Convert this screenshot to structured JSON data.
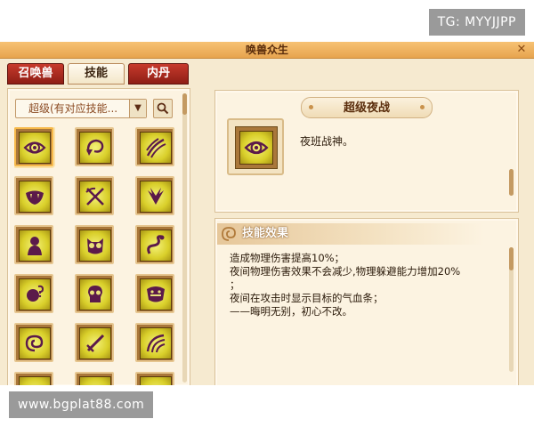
{
  "watermarks": {
    "top_right": "TG: MYYJJPP",
    "bottom_left": "www.bgplat88.com"
  },
  "window": {
    "title": "唤兽众生",
    "close_glyph": "✕"
  },
  "tabs": [
    {
      "label": "召唤兽",
      "active": false
    },
    {
      "label": "技能",
      "active": true
    },
    {
      "label": "内丹",
      "active": false
    }
  ],
  "filter": {
    "selected": "超级(有对应技能...",
    "arrow_glyph": "▼"
  },
  "skills": [
    {
      "icon": "eye-icon",
      "selected": true
    },
    {
      "icon": "swirl-arrow-icon"
    },
    {
      "icon": "claw-slash-icon"
    },
    {
      "icon": "fanged-mouth-icon"
    },
    {
      "icon": "crossed-weapons-icon"
    },
    {
      "icon": "wings-icon"
    },
    {
      "icon": "silhouette-icon"
    },
    {
      "icon": "owl-icon"
    },
    {
      "icon": "serpent-icon"
    },
    {
      "icon": "head-question-icon"
    },
    {
      "icon": "skull-icon"
    },
    {
      "icon": "beast-face-icon"
    },
    {
      "icon": "spiral-head-icon"
    },
    {
      "icon": "sword-icon"
    },
    {
      "icon": "arc-lines-icon"
    },
    {
      "icon": "partial-icon"
    },
    {
      "icon": "partial-icon"
    },
    {
      "icon": "partial-icon"
    }
  ],
  "detail": {
    "name": "超级夜战",
    "icon": "eye-icon",
    "description": "夜班战神。"
  },
  "effect": {
    "header": "技能效果",
    "lines": [
      "造成物理伤害提高10%；",
      "夜间物理伤害效果不会减少,物理躲避能力增加20%",
      "；",
      "夜间在攻击时显示目标的气血条；",
      "——晦明无别，初心不改。"
    ]
  },
  "colors": {
    "accent_red": "#8e1e16",
    "icon_gold": "#d9cf2a",
    "icon_purple": "#5b1a4a",
    "panel_bg": "#fcf3e1"
  }
}
